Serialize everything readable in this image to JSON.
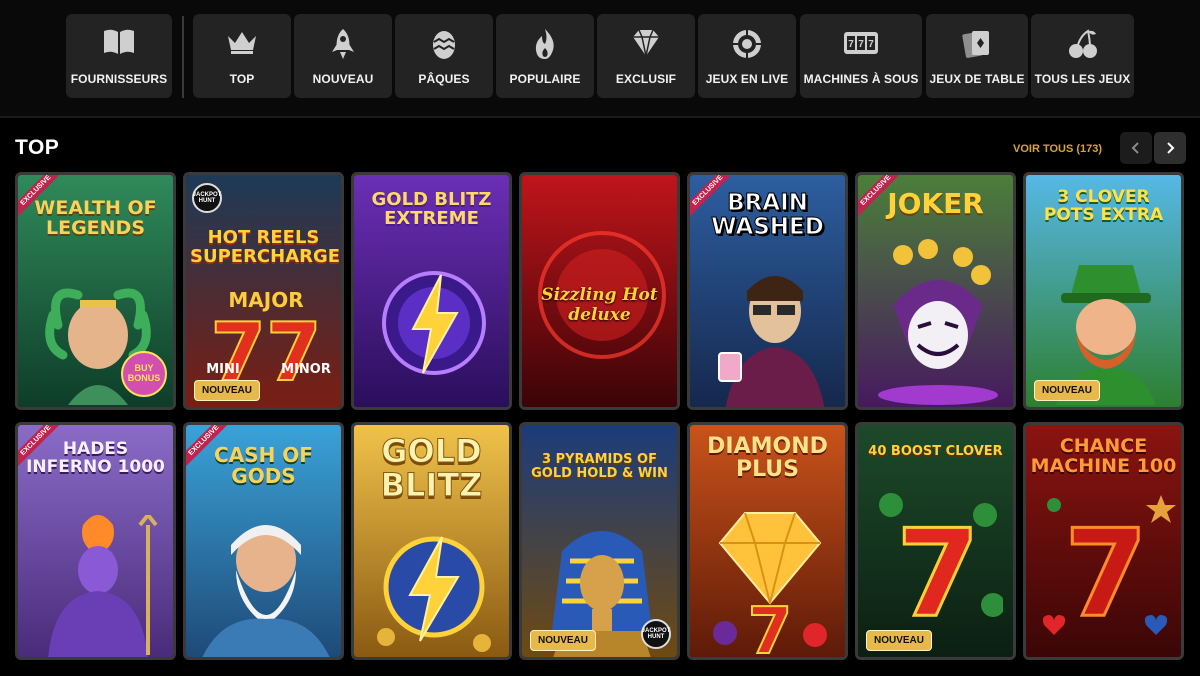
{
  "nav": {
    "providers": {
      "label": "FOURNISSEURS",
      "icon": "book-icon"
    },
    "categories": [
      {
        "label": "TOP",
        "icon": "crown-icon"
      },
      {
        "label": "NOUVEAU",
        "icon": "rocket-icon"
      },
      {
        "label": "PÂQUES",
        "icon": "easter-egg-icon"
      },
      {
        "label": "POPULAIRE",
        "icon": "flame-icon"
      },
      {
        "label": "EXCLUSIF",
        "icon": "diamond-icon"
      },
      {
        "label": "JEUX EN LIVE",
        "icon": "roulette-icon"
      },
      {
        "label": "MACHINES À SOUS",
        "icon": "slot-machine-icon"
      },
      {
        "label": "JEUX DE TABLE",
        "icon": "cards-icon"
      },
      {
        "label": "TOUS LES JEUX",
        "icon": "cherries-icon"
      }
    ]
  },
  "section": {
    "title": "TOP",
    "view_all": "VOIR TOUS (173)",
    "prev_icon": "chevron-left-icon",
    "next_icon": "chevron-right-icon"
  },
  "badges": {
    "exclusive": "EXCLUSIVE",
    "new": "NOUVEAU",
    "jackpot": "JACKPOT HUNT",
    "buy_bonus": "BUY BONUS"
  },
  "games": [
    {
      "title": "WEALTH OF LEGENDS",
      "exclusive": true,
      "new": false,
      "colors": [
        "#2f8a5a",
        "#0e3d29"
      ],
      "title_color": "#f6d35b"
    },
    {
      "title": "HOT REELS SUPERCHARGED",
      "exclusive": false,
      "new": true,
      "colors": [
        "#1d3a57",
        "#7a1e12"
      ],
      "title_color": "#ffd23a"
    },
    {
      "title": "GOLD BLITZ EXTREME",
      "exclusive": false,
      "new": false,
      "colors": [
        "#6b2fb5",
        "#2a0e5b"
      ],
      "title_color": "#ffd86a"
    },
    {
      "title": "Sizzling Hot deluxe",
      "exclusive": false,
      "new": false,
      "colors": [
        "#c0151b",
        "#3a0407"
      ],
      "title_color": "#ffd23a"
    },
    {
      "title": "BRAIN WASHED",
      "exclusive": true,
      "new": false,
      "colors": [
        "#2d5ea0",
        "#15284d"
      ],
      "title_color": "#ffffff"
    },
    {
      "title": "JOKER",
      "exclusive": true,
      "new": false,
      "colors": [
        "#4b7f3a",
        "#47195f"
      ],
      "title_color": "#ffd23a"
    },
    {
      "title": "3 CLOVER POTS EXTRA",
      "exclusive": false,
      "new": true,
      "colors": [
        "#56b8e6",
        "#2d7f2f"
      ],
      "title_color": "#ffe14a"
    },
    {
      "title": "HADES INFERNO 1000",
      "exclusive": true,
      "new": false,
      "colors": [
        "#8a6cc8",
        "#4a2b7a"
      ],
      "title_color": "#f8f0ff"
    },
    {
      "title": "CASH OF GODS",
      "exclusive": true,
      "new": false,
      "colors": [
        "#3aa2d8",
        "#1e4a78"
      ],
      "title_color": "#f6d35b"
    },
    {
      "title": "GOLD BLITZ",
      "exclusive": false,
      "new": false,
      "colors": [
        "#f0c24a",
        "#8a5a12"
      ],
      "title_color": "#fff3b0"
    },
    {
      "title": "3 PYRAMIDS OF GOLD HOLD & WIN",
      "exclusive": false,
      "new": true,
      "colors": [
        "#1b3c7a",
        "#6e4a12"
      ],
      "title_color": "#ffd23a"
    },
    {
      "title": "DIAMOND PLUS",
      "exclusive": false,
      "new": false,
      "colors": [
        "#c9531a",
        "#5e1a08"
      ],
      "title_color": "#ffe38a"
    },
    {
      "title": "40 BOOST CLOVER",
      "exclusive": false,
      "new": true,
      "colors": [
        "#1d4a2a",
        "#0b1f12"
      ],
      "title_color": "#ffd23a"
    },
    {
      "title": "CHANCE machine 100",
      "exclusive": false,
      "new": false,
      "colors": [
        "#8a1410",
        "#3b0606"
      ],
      "title_color": "#ff9a3a"
    }
  ]
}
